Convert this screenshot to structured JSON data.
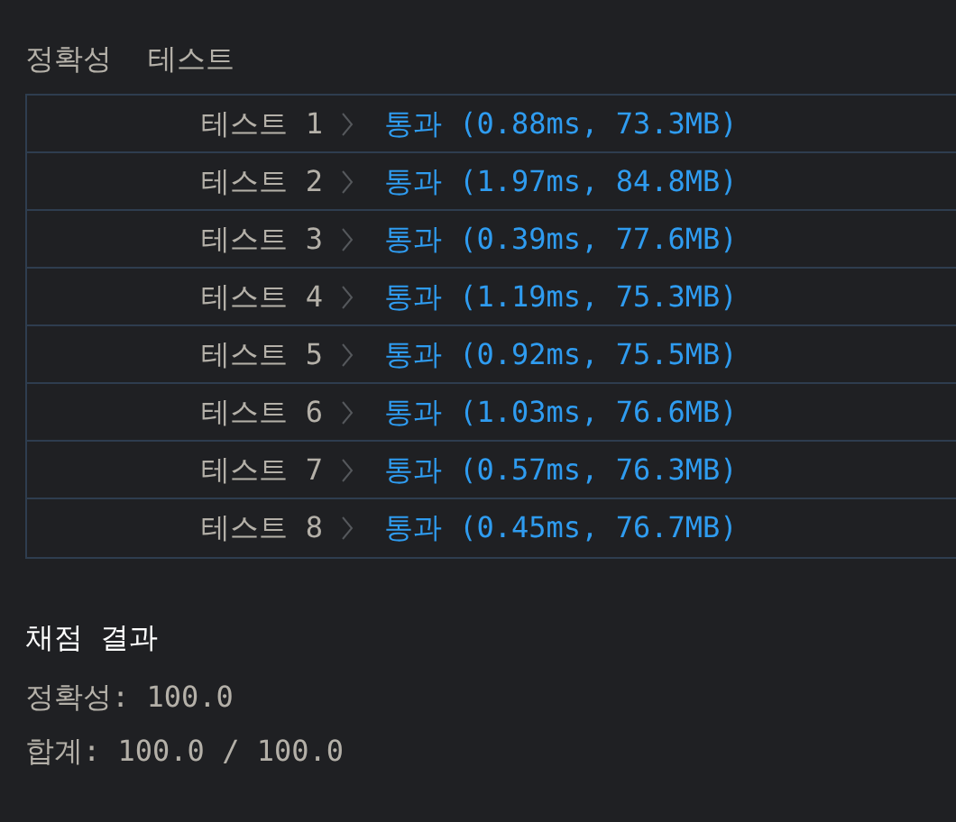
{
  "header": {
    "title": "정확성",
    "subtitle": "테스트"
  },
  "tests": [
    {
      "label": "테스트 1",
      "result": "통과 (0.88ms, 73.3MB)"
    },
    {
      "label": "테스트 2",
      "result": "통과 (1.97ms, 84.8MB)"
    },
    {
      "label": "테스트 3",
      "result": "통과 (0.39ms, 77.6MB)"
    },
    {
      "label": "테스트 4",
      "result": "통과 (1.19ms, 75.3MB)"
    },
    {
      "label": "테스트 5",
      "result": "통과 (0.92ms, 75.5MB)"
    },
    {
      "label": "테스트 6",
      "result": "통과 (1.03ms, 76.6MB)"
    },
    {
      "label": "테스트 7",
      "result": "통과 (0.57ms, 76.3MB)"
    },
    {
      "label": "테스트 8",
      "result": "통과 (0.45ms, 76.7MB)"
    }
  ],
  "summary": {
    "title": "채점 결과",
    "lines": [
      "정확성: 100.0",
      "합계: 100.0 / 100.0"
    ]
  }
}
